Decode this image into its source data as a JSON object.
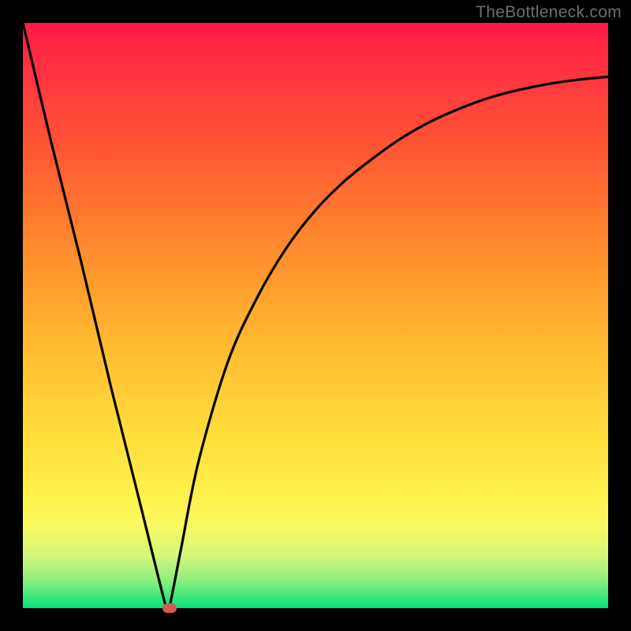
{
  "watermark": "TheBottleneck.com",
  "chart_data": {
    "type": "line",
    "title": "",
    "xlabel": "",
    "ylabel": "",
    "xlim": [
      0,
      100
    ],
    "ylim": [
      0,
      100
    ],
    "series": [
      {
        "name": "bottleneck-curve",
        "x": [
          0,
          5,
          10,
          15,
          20,
          24.5,
          25,
          27,
          30,
          35,
          40,
          45,
          50,
          55,
          60,
          65,
          70,
          75,
          80,
          85,
          90,
          95,
          100
        ],
        "values": [
          100,
          79,
          59,
          38,
          18,
          0,
          0,
          10,
          25,
          42,
          53,
          61.5,
          68,
          73,
          77,
          80.5,
          83.3,
          85.5,
          87.3,
          88.6,
          89.6,
          90.3,
          90.8
        ]
      }
    ],
    "marker": {
      "x": 25,
      "y": 0
    },
    "gradient_stops": [
      {
        "pos": 0,
        "color": "#ff1a47"
      },
      {
        "pos": 22,
        "color": "#ff5833"
      },
      {
        "pos": 55,
        "color": "#ffba30"
      },
      {
        "pos": 80,
        "color": "#fff04a"
      },
      {
        "pos": 95,
        "color": "#94ef7f"
      },
      {
        "pos": 100,
        "color": "#00e478"
      }
    ]
  }
}
